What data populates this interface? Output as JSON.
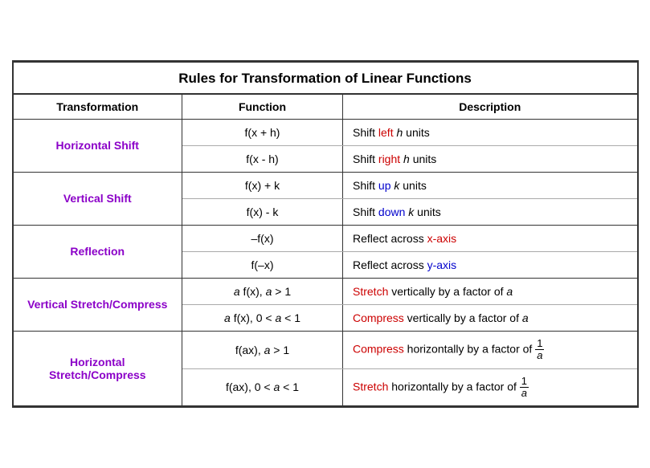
{
  "title": "Rules for Transformation of Linear Functions",
  "headers": [
    "Transformation",
    "Function",
    "Description"
  ],
  "rows": [
    {
      "group": "Horizontal Shift",
      "entries": [
        {
          "function": "f(x + h)",
          "description_parts": [
            {
              "text": "Shift "
            },
            {
              "text": "left",
              "color": "red"
            },
            {
              "text": " h units",
              "italic": true
            }
          ]
        },
        {
          "function": "f(x  - h)",
          "description_parts": [
            {
              "text": "Shift "
            },
            {
              "text": "right",
              "color": "red"
            },
            {
              "text": " h units",
              "italic": true
            }
          ]
        }
      ]
    },
    {
      "group": "Vertical Shift",
      "entries": [
        {
          "function": "f(x) + k",
          "description_parts": [
            {
              "text": "Shift "
            },
            {
              "text": "up",
              "color": "blue"
            },
            {
              "text": " k units",
              "italic": true
            }
          ]
        },
        {
          "function": "f(x) - k",
          "description_parts": [
            {
              "text": "Shift "
            },
            {
              "text": "down",
              "color": "blue"
            },
            {
              "text": " k units",
              "italic": true
            }
          ]
        }
      ]
    },
    {
      "group": "Reflection",
      "entries": [
        {
          "function": "–f(x)",
          "description_parts": [
            {
              "text": "Reflect across "
            },
            {
              "text": "x-axis",
              "color": "red"
            }
          ]
        },
        {
          "function": "f(–x)",
          "description_parts": [
            {
              "text": "Reflect across "
            },
            {
              "text": "y-axis",
              "color": "blue"
            }
          ]
        }
      ]
    },
    {
      "group": "Vertical Stretch/Compress",
      "entries": [
        {
          "function": "a f(x), a > 1",
          "description_parts": [
            {
              "text": "Stretch",
              "color": "red"
            },
            {
              "text": " vertically by a factor of "
            },
            {
              "text": "a",
              "italic": true
            }
          ]
        },
        {
          "function": "a f(x), 0 < a < 1",
          "description_parts": [
            {
              "text": "Compress",
              "color": "red"
            },
            {
              "text": " vertically by a factor of "
            },
            {
              "text": "a",
              "italic": true
            }
          ]
        }
      ]
    },
    {
      "group": "Horizontal Stretch/Compress",
      "entries": [
        {
          "function": "f(ax), a > 1",
          "description_fraction": {
            "prefix_color": "red",
            "prefix": "Compress",
            "middle": " horizontally by a factor of ",
            "num": "1",
            "den": "a"
          }
        },
        {
          "function": "f(ax), 0 < a < 1",
          "description_fraction": {
            "prefix_color": "red",
            "prefix": "Stretch",
            "middle": " horizontally by a factor of ",
            "num": "1",
            "den": "a"
          }
        }
      ]
    }
  ]
}
